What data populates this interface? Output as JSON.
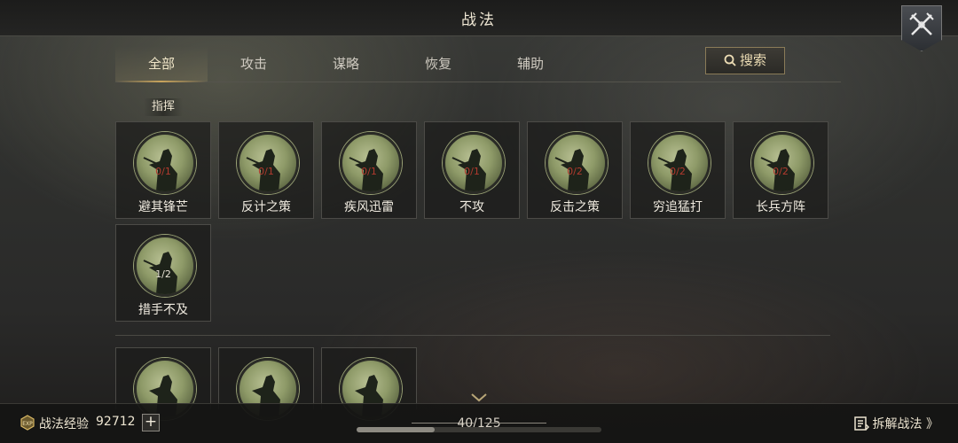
{
  "header": {
    "title": "战法"
  },
  "tabs": [
    {
      "label": "全部",
      "active": true
    },
    {
      "label": "攻击",
      "active": false
    },
    {
      "label": "谋略",
      "active": false
    },
    {
      "label": "恢复",
      "active": false
    },
    {
      "label": "辅助",
      "active": false
    }
  ],
  "search": {
    "label": "搜索",
    "icon": "search-icon"
  },
  "section": {
    "label": "指挥"
  },
  "skills": [
    {
      "name": "避其锋芒",
      "count": "0/1"
    },
    {
      "name": "反计之策",
      "count": "0/1"
    },
    {
      "name": "疾风迅雷",
      "count": "0/1"
    },
    {
      "name": "不攻",
      "count": "0/1"
    },
    {
      "name": "反击之策",
      "count": "0/2"
    },
    {
      "name": "穷追猛打",
      "count": "0/2"
    },
    {
      "name": "长兵方阵",
      "count": "0/2"
    },
    {
      "name": "措手不及",
      "count": "1/2"
    }
  ],
  "footer": {
    "exp_label": "战法经验",
    "exp_value": "92712",
    "plus_label": "+",
    "page_count": "40/125",
    "scroll_progress": 0.32,
    "disassemble_label": "拆解战法 》"
  },
  "colors": {
    "accent": "#c9a45c",
    "count_red": "#b23a2e"
  }
}
